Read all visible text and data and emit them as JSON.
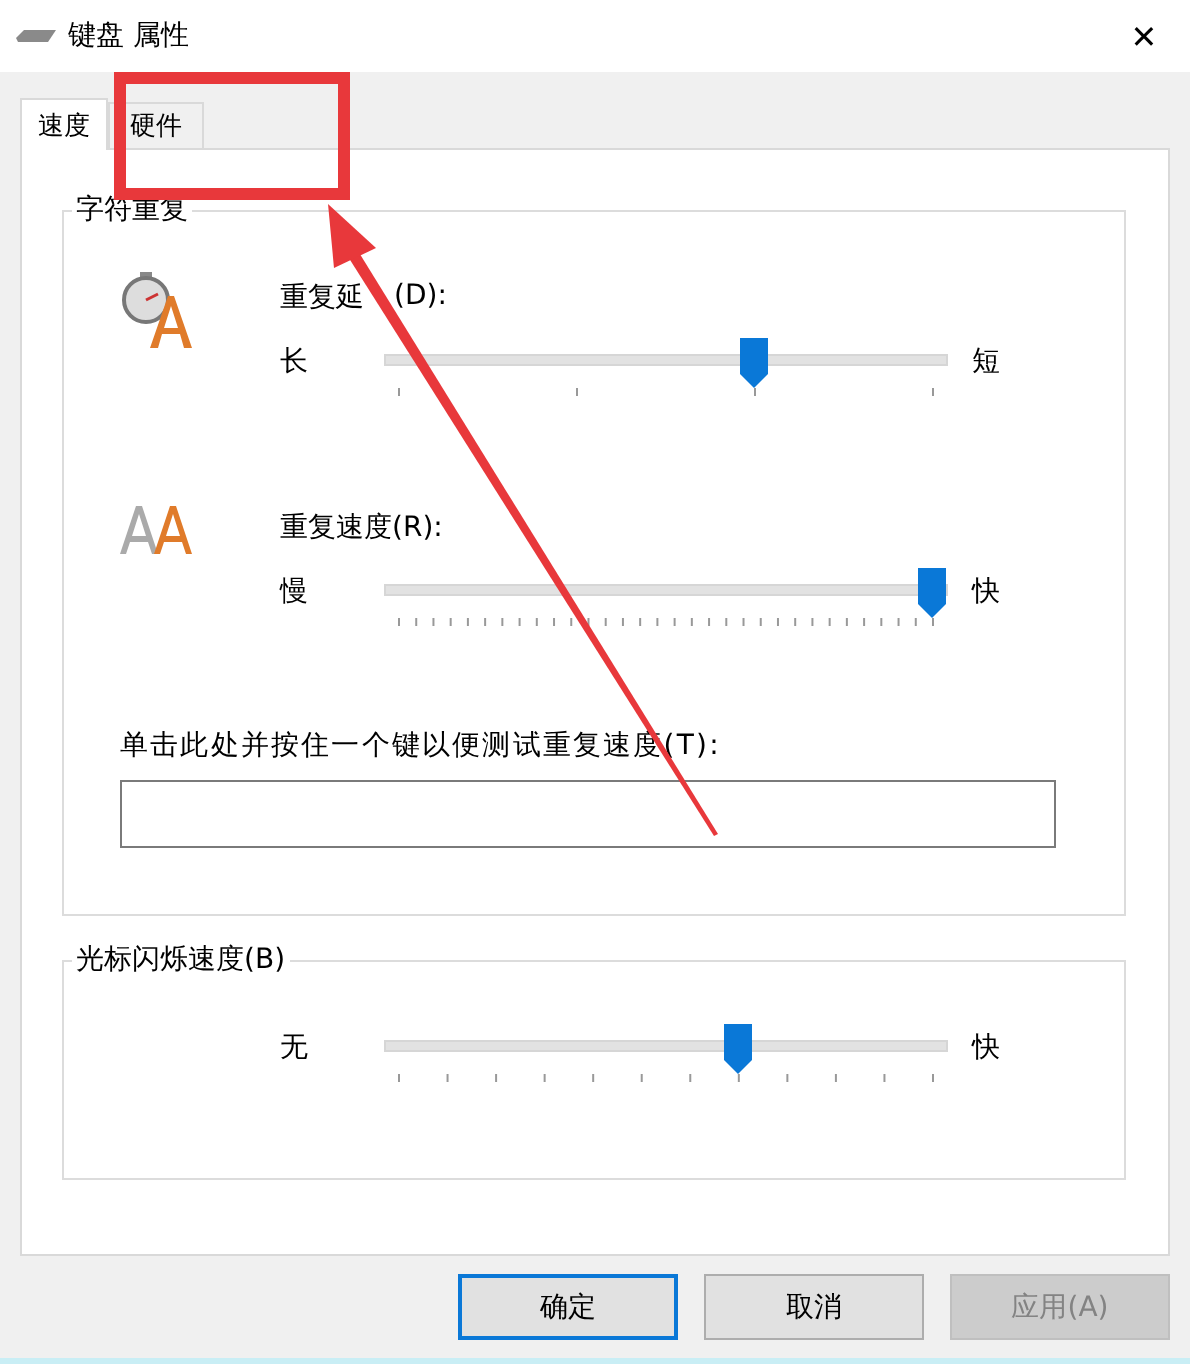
{
  "window": {
    "title": "键盘 属性",
    "close": "✕"
  },
  "tabs": [
    {
      "label": "速度",
      "selected": true
    },
    {
      "label": "硬件",
      "selected": false
    }
  ],
  "character_repeat": {
    "title": "字符重复",
    "sliders": [
      {
        "label": "重复延",
        "label_tail": "(D):",
        "min_label": "长",
        "max_label": "短",
        "level": 0.667
      },
      {
        "label": "重复速度(R):",
        "min_label": "慢",
        "max_label": "快",
        "level": 1.0
      }
    ],
    "test": {
      "label": "单击此处并按住一个键以便测试重复速度(T):"
    }
  },
  "cursor_blink": {
    "title": "光标闪烁速度(B)",
    "min_label": "无",
    "max_label": "快",
    "level": 0.636
  },
  "buttons": [
    {
      "label": "确定",
      "default": true,
      "disabled": false
    },
    {
      "label": "取消",
      "default": false,
      "disabled": false
    },
    {
      "label": "应用(A)",
      "default": false,
      "disabled": true
    }
  ]
}
